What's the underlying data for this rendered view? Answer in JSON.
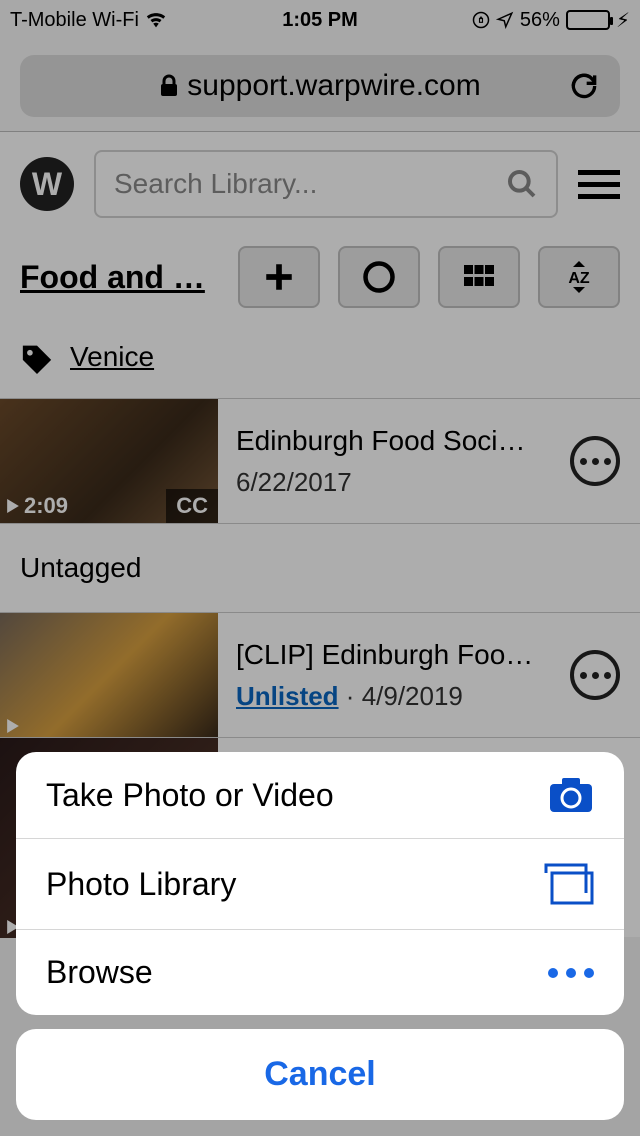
{
  "status": {
    "carrier": "T-Mobile Wi-Fi",
    "time": "1:05 PM",
    "battery_pct": "56%",
    "battery_fill_pct": 56
  },
  "browser": {
    "url": "support.warpwire.com"
  },
  "header": {
    "search_placeholder": "Search Library..."
  },
  "toolbar": {
    "title": "Food and …"
  },
  "tag": {
    "label": "Venice"
  },
  "section_untagged": "Untagged",
  "items": [
    {
      "title": "Edinburgh Food Soci…",
      "date": "6/22/2017",
      "duration": "2:09",
      "cc": "CC"
    },
    {
      "title": "[CLIP] Edinburgh Foo…",
      "status": "Unlisted",
      "sep": " · ",
      "date": "4/9/2019"
    }
  ],
  "sheet": {
    "opt1": "Take Photo or Video",
    "opt2": "Photo Library",
    "opt3": "Browse",
    "cancel": "Cancel"
  }
}
